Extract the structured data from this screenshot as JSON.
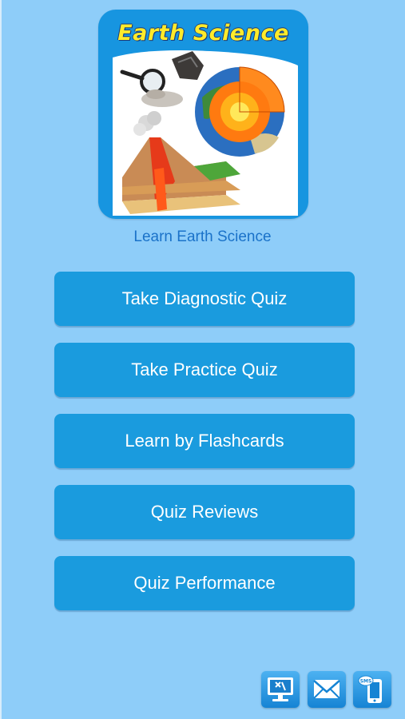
{
  "app": {
    "logo_title": "Earth Science",
    "app_name": "Learn Earth Science"
  },
  "menu": [
    {
      "label": "Take Diagnostic Quiz"
    },
    {
      "label": "Take Practice Quiz"
    },
    {
      "label": "Learn by Flashcards"
    },
    {
      "label": "Quiz Reviews"
    },
    {
      "label": "Quiz Performance"
    }
  ],
  "dock": [
    {
      "icon": "computer-tools-icon"
    },
    {
      "icon": "email-icon"
    },
    {
      "icon": "sms-phone-icon",
      "badge": "SMS"
    }
  ],
  "colors": {
    "background": "#8ecdf9",
    "button": "#1a9bde",
    "app_name_text": "#1a72c9",
    "logo_title": "#ffeb2a"
  }
}
